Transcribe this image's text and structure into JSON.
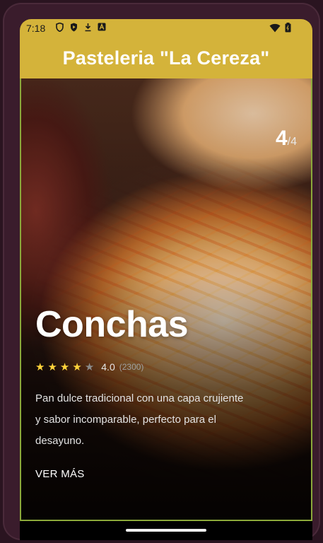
{
  "status_bar": {
    "time": "7:18",
    "left_icons": [
      "shield-icon",
      "play-protect-icon",
      "download-icon",
      "a-badge-icon"
    ],
    "right_icons": [
      "wifi-icon",
      "battery-icon"
    ]
  },
  "app_bar": {
    "title": "Pasteleria \"La Cereza\""
  },
  "carousel": {
    "current_page": "4",
    "total_pages": "/4"
  },
  "product": {
    "name": "Conchas",
    "rating": 4.0,
    "rating_text": "4.0",
    "rating_count": "(2300)",
    "description": "Pan dulce tradicional con una capa crujiente y sabor incomparable, perfecto para el desayuno.",
    "more_label": "VER MÁS"
  },
  "colors": {
    "accent": "#d4b33a",
    "star": "#ffd43b",
    "border": "#8ba83a"
  }
}
